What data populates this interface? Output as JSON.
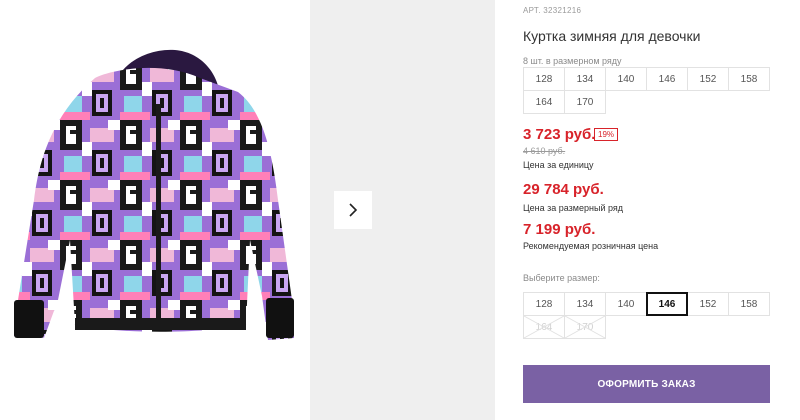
{
  "product": {
    "art": "АРТ. 32321216",
    "title": "Куртка зимняя для девочки"
  },
  "pack": {
    "label": "8 шт. в размерном ряду",
    "sizes": [
      "128",
      "134",
      "140",
      "146",
      "152",
      "158",
      "164",
      "170"
    ]
  },
  "prices": {
    "unit_price": "3 723 руб.",
    "discount": "19%",
    "old_price": "4 610 руб.",
    "unit_label": "Цена за единицу",
    "pack_price": "29 784 руб.",
    "pack_label": "Цена за размерный ряд",
    "rrp_price": "7 199 руб.",
    "rrp_label": "Рекомендуемая розничная цена"
  },
  "size_select": {
    "label": "Выберите размер:",
    "sizes": [
      "128",
      "134",
      "140",
      "146",
      "152",
      "158",
      "164",
      "170"
    ],
    "selected": "146",
    "disabled": [
      "164",
      "170"
    ]
  },
  "order_button": "ОФОРМИТЬ ЗАКАЗ",
  "icons": {
    "next": "chevron-right-icon"
  },
  "colors": {
    "price": "#d8232a",
    "button": "#7a61a4",
    "thumb_bg": "#efefef"
  }
}
